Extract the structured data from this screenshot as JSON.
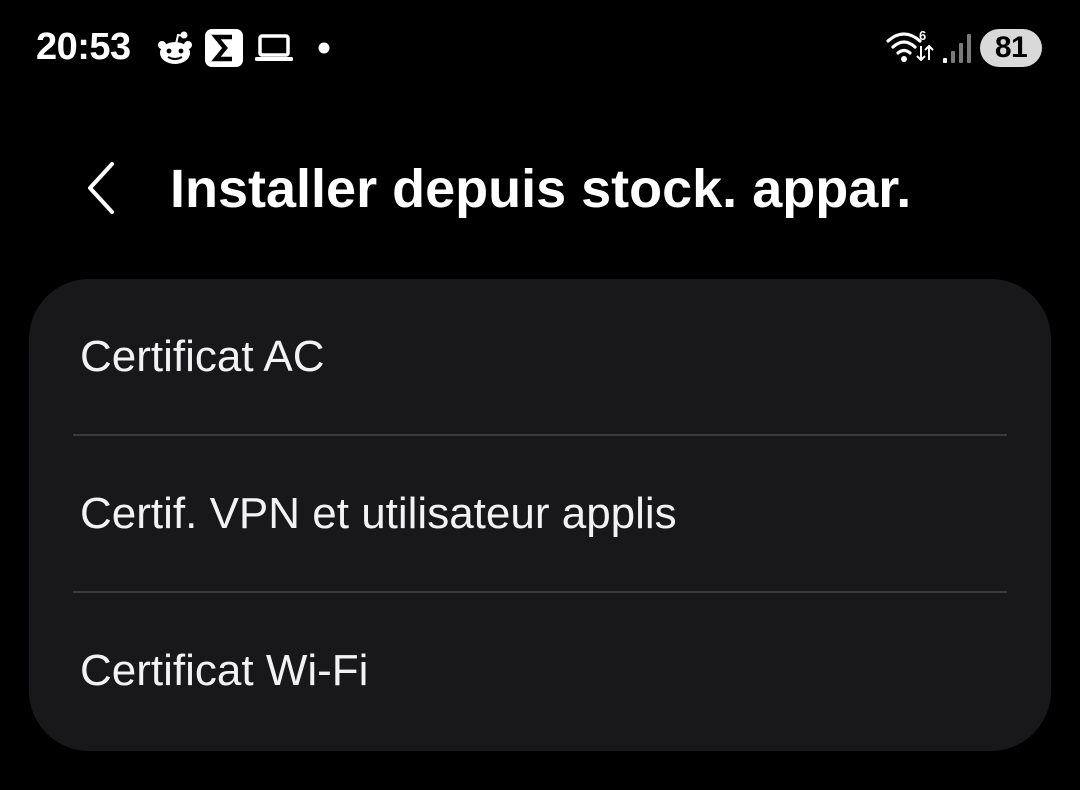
{
  "status_bar": {
    "time": "20:53",
    "notification_icons": [
      "reddit-icon",
      "sigma-app-icon",
      "laptop-icon",
      "dot-icon"
    ],
    "wifi_badge": "6",
    "battery_level": "81"
  },
  "header": {
    "back_icon": "chevron-left-icon",
    "title": "Installer depuis stock. appar."
  },
  "list": {
    "items": [
      {
        "label": "Certificat AC"
      },
      {
        "label": "Certif. VPN et utilisateur applis"
      },
      {
        "label": "Certificat Wi-Fi"
      }
    ]
  },
  "colors": {
    "background": "#000000",
    "card_background": "#18181a",
    "divider": "#3a3a3c",
    "text_primary": "#ffffff",
    "battery_pill": "#d9d9d9"
  }
}
